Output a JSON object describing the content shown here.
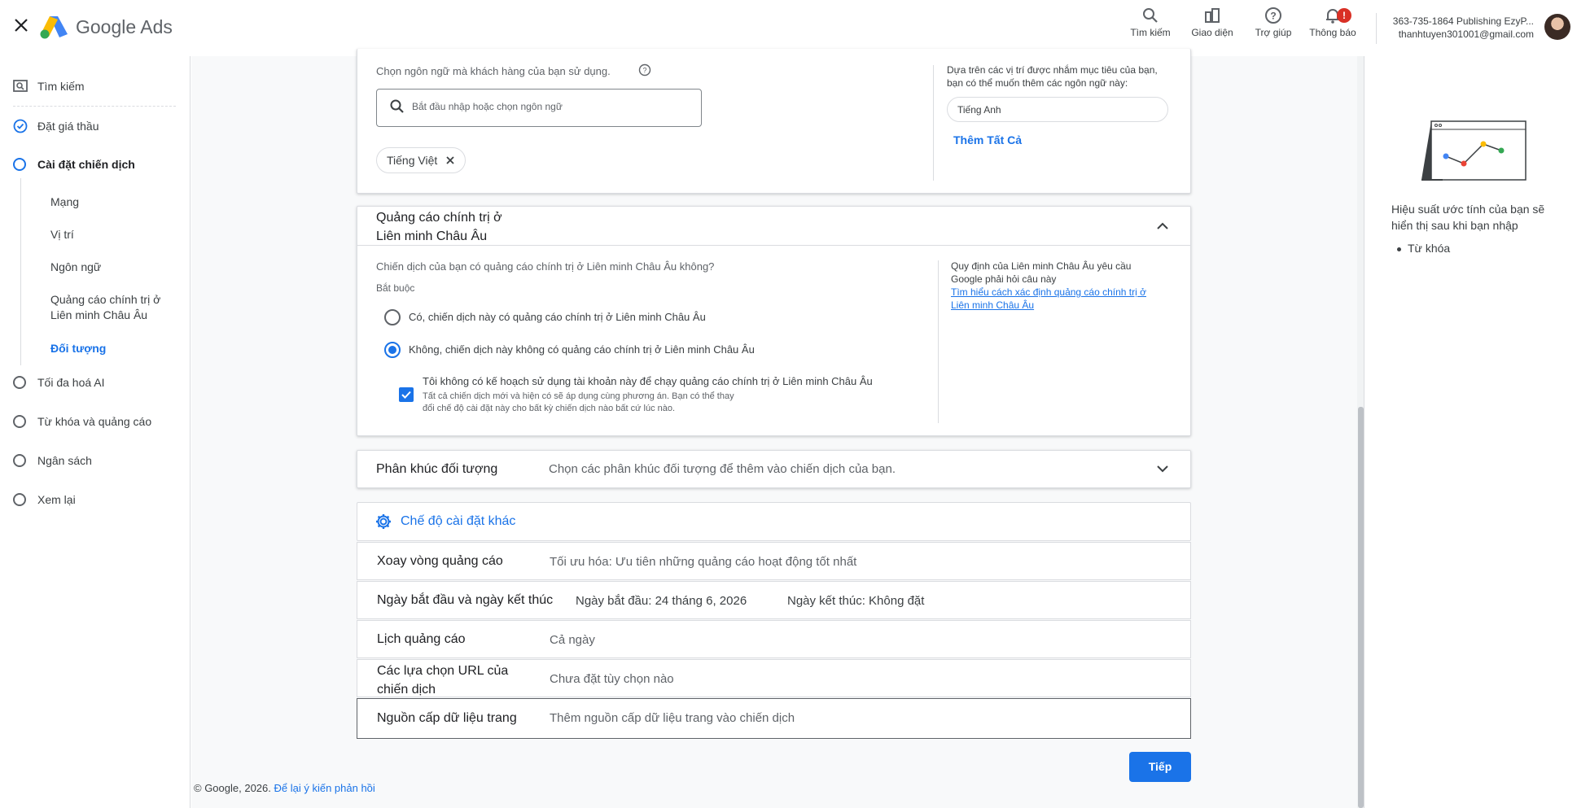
{
  "header": {
    "brand": "Google Ads",
    "tools": [
      {
        "label": "Tìm kiếm",
        "icon": "search-icon"
      },
      {
        "label": "Giao diện",
        "icon": "appearance-icon"
      },
      {
        "label": "Trợ giúp",
        "icon": "help-icon"
      },
      {
        "label": "Thông báo",
        "icon": "bell-icon"
      }
    ],
    "notification_badge": "!",
    "account_name": "363-735-1864 Publishing EzyP...",
    "account_email": "thanhtuyen301001@gmail.com"
  },
  "sidebar": {
    "search": "Tìm kiếm",
    "bid": "Đặt giá thầu",
    "campaign_settings": "Cài đặt chiến dịch",
    "sub": [
      "Mạng",
      "Vị trí",
      "Ngôn ngữ",
      "Quảng cáo chính trị ở Liên minh Châu Âu",
      "Đối tượng"
    ],
    "ai_max": "Tối đa hoá AI",
    "keywords_ads": "Từ khóa và quảng cáo",
    "budget": "Ngân sách",
    "review": "Xem lại"
  },
  "language": {
    "prompt": "Chọn ngôn ngữ mà khách hàng của bạn sử dụng.",
    "placeholder": "Bắt đầu nhập hoặc chọn ngôn ngữ",
    "selected_chip": "Tiếng Việt",
    "suggest_text": "Dựa trên các vị trí được nhắm mục tiêu của bạn, bạn có thể muốn thêm các ngôn ngữ này:",
    "suggest_pill": "Tiếng Anh",
    "add_all": "Thêm Tất Cả"
  },
  "eu_political": {
    "title_line1": "Quảng cáo chính trị ở",
    "title_line2": "Liên minh Châu Âu",
    "question": "Chiến dịch của bạn có quảng cáo chính trị ở Liên minh Châu Âu không?",
    "required": "Bắt buộc",
    "option_yes": "Có, chiến dịch này có quảng cáo chính trị ở Liên minh Châu Âu",
    "option_no": "Không, chiến dịch này không có quảng cáo chính trị ở Liên minh Châu Âu",
    "selected": "no",
    "check_label": "Tôi không có kế hoạch sử dụng tài khoản này để chạy quảng cáo chính trị ở Liên minh Châu Âu",
    "check_help_line1": "Tất cả chiến dịch mới và hiện có sẽ áp dụng cùng phương án. Bạn có thể thay",
    "check_help_line2": "đổi chế độ cài đặt này cho bất kỳ chiến dịch nào bất cứ lúc nào.",
    "checked": true,
    "side_line1": "Quy định của Liên minh Châu Âu yêu cầu",
    "side_line2": "Google phải hỏi câu này",
    "side_link1": "Tìm hiểu cách xác định quảng cáo chính trị ở",
    "side_link2": "Liên minh Châu Âu"
  },
  "audience": {
    "title": "Phân khúc đối tượng",
    "desc": "Chọn các phân khúc đối tượng để thêm vào chiến dịch của bạn."
  },
  "other_settings": "Chế độ cài đặt khác",
  "rows": {
    "rotation_k": "Xoay vòng quảng cáo",
    "rotation_v": "Tối ưu hóa: Ưu tiên những quảng cáo hoạt động tốt nhất",
    "dates_k": "Ngày bắt đầu và ngày kết thúc",
    "dates_start": "Ngày bắt đầu: 24 tháng 6, 2026",
    "dates_end": "Ngày kết thúc: Không đặt",
    "schedule_k": "Lịch quảng cáo",
    "schedule_v": "Cả ngày",
    "url_k1": "Các lựa chọn URL của",
    "url_k2": "chiến dịch",
    "url_v": "Chưa đặt tùy chọn nào",
    "feed_k": "Nguồn cấp dữ liệu trang",
    "feed_v": "Thêm nguồn cấp dữ liệu trang vào chiến dịch"
  },
  "next_button": "Tiếp",
  "footer": {
    "copyright": "© Google, 2026.",
    "feedback": "Để lại ý kiến phản hồi"
  },
  "right_panel": {
    "text_line1": "Hiệu suất ước tính của bạn sẽ",
    "text_line2": "hiển thị sau khi bạn nhập",
    "bullet": "Từ khóa"
  },
  "colors": {
    "accent": "#1a73e8",
    "badge": "#d93025"
  }
}
